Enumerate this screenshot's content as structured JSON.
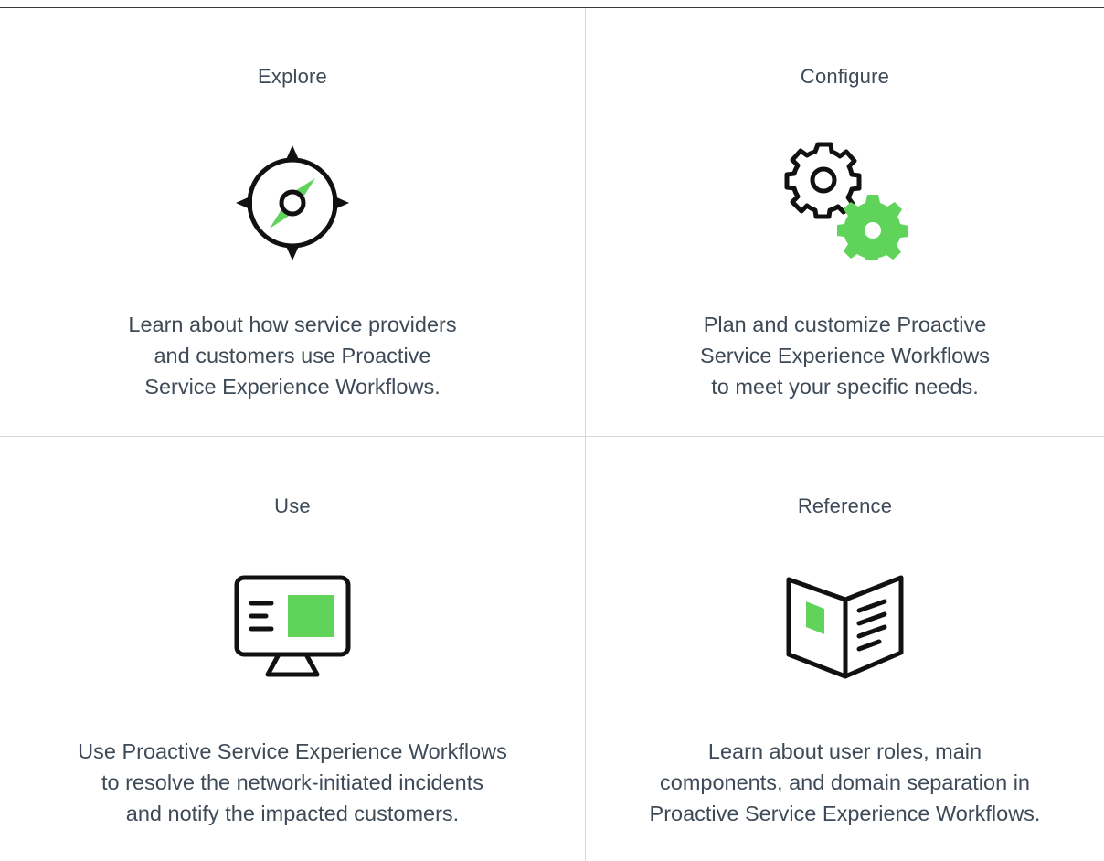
{
  "colors": {
    "accent": "#5fd35a",
    "text": "#3e4a57",
    "icon_stroke": "#111111",
    "divider": "#d8d8d8"
  },
  "cards": [
    {
      "title": "Explore",
      "icon": "compass-icon",
      "desc_lines": [
        "Learn about how service providers",
        "and customers use Proactive",
        "Service Experience Workflows."
      ]
    },
    {
      "title": "Configure",
      "icon": "gears-icon",
      "desc_lines": [
        "Plan and customize Proactive",
        "Service Experience Workflows",
        "to meet your specific needs."
      ]
    },
    {
      "title": "Use",
      "icon": "monitor-icon",
      "desc_lines": [
        "Use Proactive Service Experience Workflows",
        "to resolve the network-initiated incidents",
        "and notify the impacted customers."
      ]
    },
    {
      "title": "Reference",
      "icon": "open-book-icon",
      "desc_lines": [
        "Learn about user roles, main",
        "components, and domain separation in",
        "Proactive Service Experience Workflows."
      ]
    }
  ]
}
